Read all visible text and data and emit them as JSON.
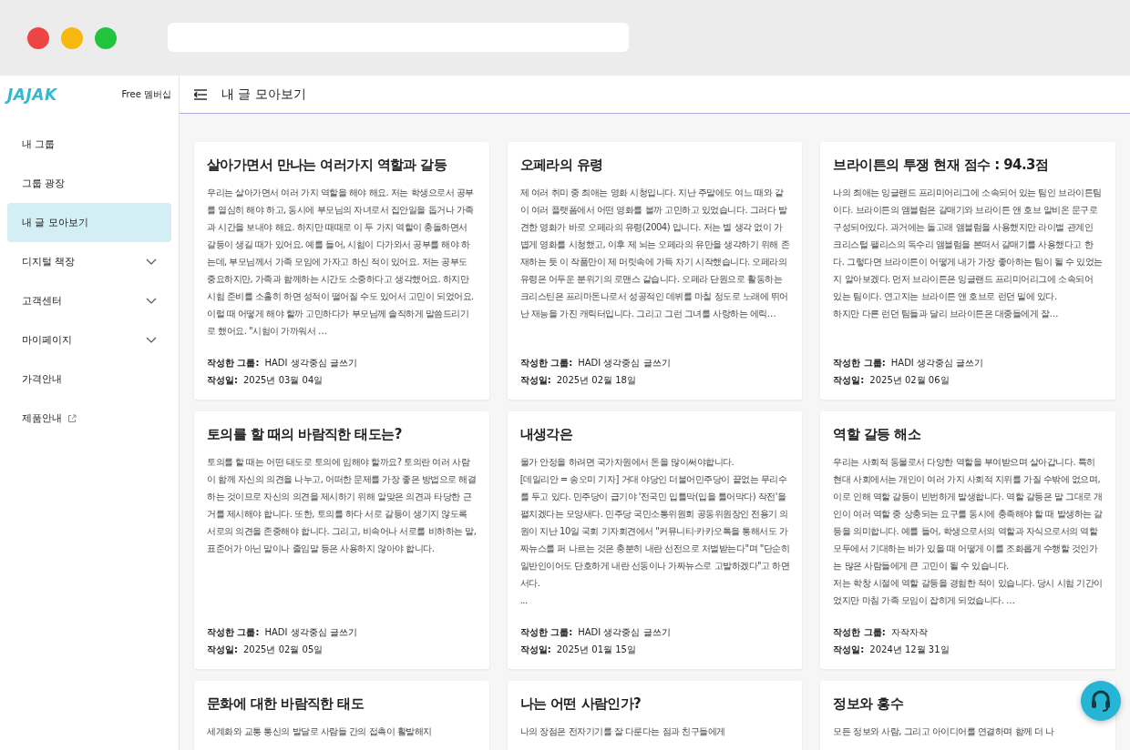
{
  "sidebar": {
    "logo": "JAJAK",
    "membership": "Free 멤버십",
    "items": [
      {
        "label": "내 그룹",
        "kind": "plain",
        "selected": false
      },
      {
        "label": "그룹 광장",
        "kind": "plain",
        "selected": false
      },
      {
        "label": "내 글 모아보기",
        "kind": "plain",
        "selected": true
      },
      {
        "label": "디지털 책장",
        "kind": "dropdown",
        "selected": false
      },
      {
        "label": "고객센터",
        "kind": "dropdown",
        "selected": false
      },
      {
        "label": "마이페이지",
        "kind": "dropdown",
        "selected": false
      },
      {
        "label": "가격안내",
        "kind": "plain",
        "selected": false
      },
      {
        "label": "제품안내",
        "kind": "external",
        "selected": false
      }
    ]
  },
  "header": {
    "title": "내 글 모아보기"
  },
  "posts": [
    {
      "title": "살아가면서 만나는 여러가지 역할과 갈등",
      "excerpt": "우리는 살아가면서 여러 가지 역할을 해야 해요. 저는 학생으로서 공부를 열심히 해야 하고, 동시에 부모님의 자녀로서 집안일을 돕거나 가족과 시간을 보내야 해요. 하지만 때때로 이 두 가지 역할이 충돌하면서 갈등이 생길 때가 있어요. 예를 들어, 시험이 다가와서 공부를 해야 하는데, 부모님께서 가족 모임에 가자고 하신 적이 있어요. 저는 공부도 중요하지만, 가족과 함께하는 시간도 소중하다고 생각했어요. 하지만 시험 준비를 소홀히 하면 성적이 떨어질 수도 있어서 고민이 되었어요. 이럴 때 어떻게 해야 할까 고민하다가 부모님께 솔직하게 말씀드리기로 했어요. \"시험이 가까워서 …",
      "group_label": "작성한 그룹:",
      "group": "HADI 생각중심 글쓰기",
      "date_label": "작성일:",
      "date": "2025년 03월 04일"
    },
    {
      "title": "오페라의 유령",
      "excerpt": "제 여러 취미 중 최애는 영화 시청입니다. 지난 주말에도 여느 때와 같이 여러 플랫폼에서 어떤 영화를 볼까 고민하고 있었습니다. 그러다 발견한 영화가 바로 오페라의 유령(2004) 입니다. 저는 별 생각 없이 가볍게 영화를 시청했고, 이후 제 뇌는 오페라의 유만을 생각하기 위해 존재하는 듯 이 작품만이 제 머릿속에 가득 차기 시작했습니다. 오페라의 유령은 어두운 분위기의 로맨스 같습니다. 오페라 단원으로 활동하는 크리스틴은 프리마돈나로서 성공적인 데뷔를 마칠 정도로 노래에 뛰어난 재능을 가진 캐릭터입니다. 그리고 그런 그녀를 사랑하는 에릭…",
      "group_label": "작성한 그룹:",
      "group": "HADI 생각중심 글쓰기",
      "date_label": "작성일:",
      "date": "2025년 02월 18일"
    },
    {
      "title": "브라이튼의 투쟁 현재 점수 : 94.3점",
      "excerpt": "나의 최애는 잉글랜드 프리미어리그에 소속되어 있는 팀인 브라이튼팀이다. 브라이튼의 앰블럼은 갈매기와 브라이튼 앤 호브 알비온 문구로 구성되어있다. 과거에는 돌고래 앰블럼을 사용했지만 라이벌 관계인 크리스털 팰리스의 독수리 앰블럼을 본떠서 갈매기를 사용했다고 한다. 그렇다면 브라이튼이 어떻게 내가 가장 좋아하는 팀이 될 수 있었는지 알아보겠다. 먼저 브라이튼은 잉글랜드 프리미어리그에 소속되어 있는 팀이다. 연고지는 브라이튼 앤 호브로 런던 밑에 있다.\n 하지만 다른 런던 팀들과 달리 브라이튼은 대중들에게 잘…",
      "group_label": "작성한 그룹:",
      "group": "HADI 생각중심 글쓰기",
      "date_label": "작성일:",
      "date": "2025년 02월 06일"
    },
    {
      "title": "토의를 할 때의 바람직한 태도는?",
      "excerpt": "토의를 할 때는 어떤 태도로 토의에 임해야 할까요? 토의란 여러 사람이 함께 자신의 의견을 나누고, 어떠한 문제를 가장 좋은 방법으로 해결하는 것이므로 자신의 의견을 제시하기 위해 알맞은 의견과 타당한 근거를 제시해야 합니다. 또한, 토의를 하다 서로 갈등이 생기지 않도록 서로의 의견을 존중해야 합니다. 그리고, 비속어나 서로를 비하하는 말, 표준어가 아닌 말이나 줄임말 등은 사용하지 않아야 합니다.",
      "group_label": "작성한 그룹:",
      "group": "HADI 생각중심 글쓰기",
      "date_label": "작성일:",
      "date": "2025년 02월 05일"
    },
    {
      "title": "내생각은",
      "excerpt": "물가 안정을 하려면 국가차원에서 돈을 많이써야합니다.\n[데일리안 = 송오미 기자] 거대 야당인 더불어민주당이 끝없는 무리수를 두고 있다. 민주당이 급기야 '전국민 입틀막(입을 틀어막다) 작전'을 펼치겠다는 모양새다. 민주당 국민소통위원회 공동위원장인 전용기 의원이 지난 10일 국회 기자회견에서 \"커뮤니티·카카오톡을 통해서도 가짜뉴스를 퍼 나르는 것은 충분히 내란 선전으로 처벌받는다\"며 \"단순히 일반인이어도 단호하게 내란 선동이나 가짜뉴스로 고발하겠다\"고 하면서다.\n...",
      "group_label": "작성한 그룹:",
      "group": "HADI 생각중심 글쓰기",
      "date_label": "작성일:",
      "date": "2025년 01월 15일"
    },
    {
      "title": "역할 갈등 해소",
      "excerpt": "우리는 사회적 동물로서 다양한 역할을 부여받으며 살아갑니다. 특히 현대 사회에서는 개인이 여러 가지 사회적 지위를 가질 수밖에 없으며, 이로 인해 역할 갈등이 빈번하게 발생합니다. 역할 갈등은 말 그대로 개인이 여러 역할 중 상충되는 요구를 동시에 충족해야 할 때 발생하는 갈등을 의미합니다. 예를 들어, 학생으로서의 역할과 자식으로서의 역할 모두에서 기대하는 바가 있을 때 어떻게 이를 조화롭게 수행할 것인가는 많은 사람들에게 큰 고민이 될 수 있습니다.\n저는 학창 시절에 역할 갈등을 경험한 적이 있습니다. 당시 시험 기간이었지만 마침 가족 모임이 잡히게 되었습니다. …",
      "group_label": "작성한 그룹:",
      "group": "자작자작",
      "date_label": "작성일:",
      "date": "2024년 12월 31일"
    },
    {
      "title": "문화에 대한 바람직한 태도",
      "excerpt": "세계화와 교통 통신의 발달로 사람들 간의 접촉이 활발해지"
    },
    {
      "title": "나는 어떤 사람인가?",
      "excerpt": "나의 장점은 전자기기를 잘 다룬다는 점과 친구들에게"
    },
    {
      "title": "정보와 홍수",
      "excerpt": "모든 정보와 사람, 그리고 아이디어를 연결하며 함께 더 나"
    }
  ]
}
